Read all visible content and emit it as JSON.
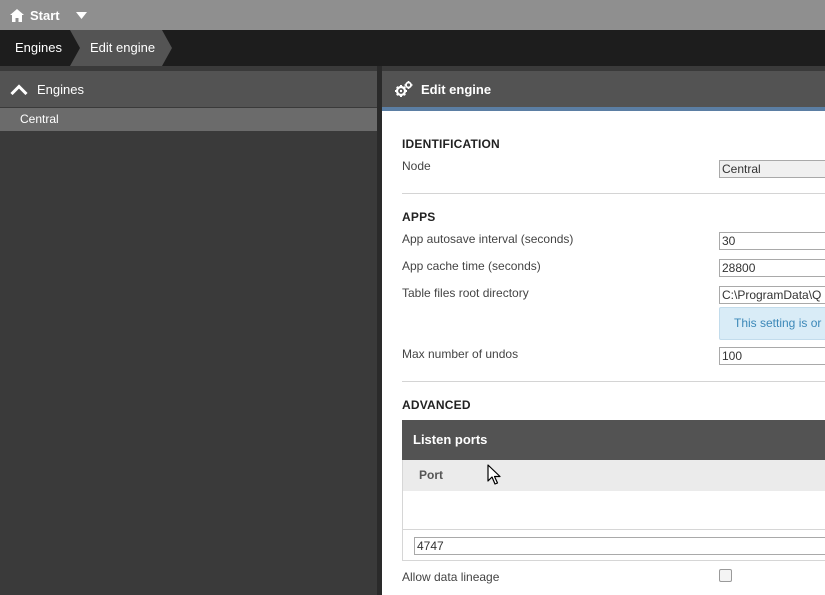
{
  "topbar": {
    "home_label": "Start"
  },
  "breadcrumb": {
    "items": [
      "Engines",
      "Edit engine"
    ]
  },
  "sidebar": {
    "header": "Engines",
    "items": [
      "Central"
    ]
  },
  "panel": {
    "title": "Edit engine",
    "identification": {
      "heading": "IDENTIFICATION",
      "node_label": "Node",
      "node_value": "Central"
    },
    "apps": {
      "heading": "APPS",
      "autosave_label": "App autosave interval (seconds)",
      "autosave_value": "30",
      "cache_label": "App cache time (seconds)",
      "cache_value": "28800",
      "tablefiles_label": "Table files root directory",
      "tablefiles_value": "C:\\ProgramData\\Q",
      "info_text": "This setting is or",
      "undos_label": "Max number of undos",
      "undos_value": "100"
    },
    "advanced": {
      "heading": "ADVANCED",
      "listen_ports_title": "Listen ports",
      "port_column": "Port",
      "port_value": "4747",
      "data_lineage_label": "Allow data lineage",
      "data_lineage_checked": false
    }
  }
}
